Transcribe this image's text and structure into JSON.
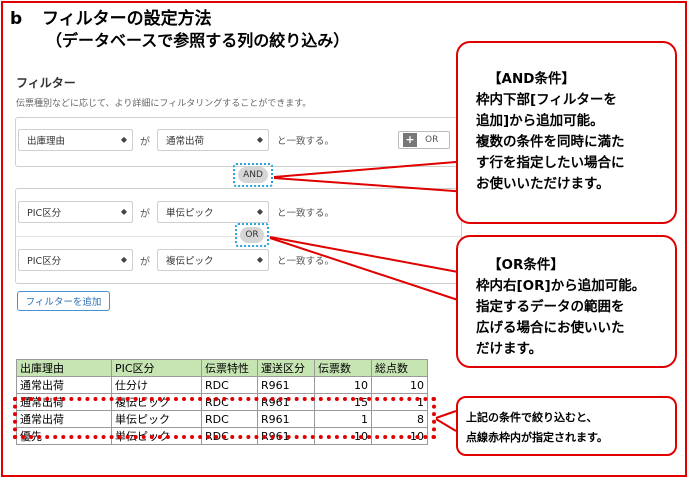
{
  "heading": {
    "letter": "b",
    "title": "フィルターの設定方法",
    "subtitle": "（データベースで参照する列の絞り込み）"
  },
  "filter_panel": {
    "title": "フィルター",
    "description": "伝票種別などに応じて、より詳細にフィルタリングすることができます。",
    "ga": "が",
    "tail": "と一致する。",
    "rows": [
      {
        "field": "出庫理由",
        "value": "通常出荷"
      },
      {
        "field": "PIC区分",
        "value": "単伝ピック"
      },
      {
        "field": "PIC区分",
        "value": "複伝ピック"
      }
    ],
    "and_label": "AND",
    "or_label": "OR",
    "or_button_label": "OR",
    "add_button_label": "フィルターを追加"
  },
  "callouts": {
    "and": {
      "title": "【AND条件】",
      "lines": [
        "枠内下部[フィルターを",
        "追加]から追加可能。",
        "複数の条件を同時に満た",
        "す行を指定したい場合に",
        "お使いいただけます。"
      ]
    },
    "or": {
      "title": "【OR条件】",
      "lines": [
        "枠内右[OR]から追加可能。",
        "指定するデータの範囲を",
        "広げる場合にお使いいた",
        "だけます。"
      ]
    },
    "result": {
      "lines": [
        "上記の条件で絞り込むと、",
        "点線赤枠内が指定されます。"
      ]
    }
  },
  "table": {
    "headers": [
      "出庫理由",
      "PIC区分",
      "伝票特性",
      "運送区分",
      "伝票数",
      "総点数"
    ],
    "rows": [
      [
        "通常出荷",
        "仕分け",
        "RDC",
        "R961",
        "10",
        "10"
      ],
      [
        "通常出荷",
        "複伝ピック",
        "RDC",
        "R961",
        "15",
        "1"
      ],
      [
        "通常出荷",
        "単伝ピック",
        "RDC",
        "R961",
        "1",
        "8"
      ],
      [
        "優先",
        "単伝ピック",
        "RDC",
        "R961",
        "10",
        "10"
      ]
    ]
  },
  "colors": {
    "accent_red": "#e00000",
    "highlight_blue": "#2aa4dc",
    "table_header_green": "#c6e5b3"
  }
}
